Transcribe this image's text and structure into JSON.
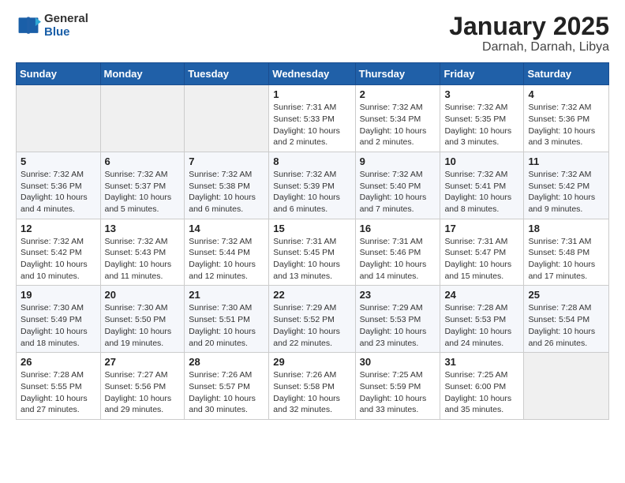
{
  "header": {
    "logo_general": "General",
    "logo_blue": "Blue",
    "title": "January 2025",
    "location": "Darnah, Darnah, Libya"
  },
  "days_of_week": [
    "Sunday",
    "Monday",
    "Tuesday",
    "Wednesday",
    "Thursday",
    "Friday",
    "Saturday"
  ],
  "weeks": [
    [
      {
        "day": "",
        "info": ""
      },
      {
        "day": "",
        "info": ""
      },
      {
        "day": "",
        "info": ""
      },
      {
        "day": "1",
        "info": "Sunrise: 7:31 AM\nSunset: 5:33 PM\nDaylight: 10 hours\nand 2 minutes."
      },
      {
        "day": "2",
        "info": "Sunrise: 7:32 AM\nSunset: 5:34 PM\nDaylight: 10 hours\nand 2 minutes."
      },
      {
        "day": "3",
        "info": "Sunrise: 7:32 AM\nSunset: 5:35 PM\nDaylight: 10 hours\nand 3 minutes."
      },
      {
        "day": "4",
        "info": "Sunrise: 7:32 AM\nSunset: 5:36 PM\nDaylight: 10 hours\nand 3 minutes."
      }
    ],
    [
      {
        "day": "5",
        "info": "Sunrise: 7:32 AM\nSunset: 5:36 PM\nDaylight: 10 hours\nand 4 minutes."
      },
      {
        "day": "6",
        "info": "Sunrise: 7:32 AM\nSunset: 5:37 PM\nDaylight: 10 hours\nand 5 minutes."
      },
      {
        "day": "7",
        "info": "Sunrise: 7:32 AM\nSunset: 5:38 PM\nDaylight: 10 hours\nand 6 minutes."
      },
      {
        "day": "8",
        "info": "Sunrise: 7:32 AM\nSunset: 5:39 PM\nDaylight: 10 hours\nand 6 minutes."
      },
      {
        "day": "9",
        "info": "Sunrise: 7:32 AM\nSunset: 5:40 PM\nDaylight: 10 hours\nand 7 minutes."
      },
      {
        "day": "10",
        "info": "Sunrise: 7:32 AM\nSunset: 5:41 PM\nDaylight: 10 hours\nand 8 minutes."
      },
      {
        "day": "11",
        "info": "Sunrise: 7:32 AM\nSunset: 5:42 PM\nDaylight: 10 hours\nand 9 minutes."
      }
    ],
    [
      {
        "day": "12",
        "info": "Sunrise: 7:32 AM\nSunset: 5:42 PM\nDaylight: 10 hours\nand 10 minutes."
      },
      {
        "day": "13",
        "info": "Sunrise: 7:32 AM\nSunset: 5:43 PM\nDaylight: 10 hours\nand 11 minutes."
      },
      {
        "day": "14",
        "info": "Sunrise: 7:32 AM\nSunset: 5:44 PM\nDaylight: 10 hours\nand 12 minutes."
      },
      {
        "day": "15",
        "info": "Sunrise: 7:31 AM\nSunset: 5:45 PM\nDaylight: 10 hours\nand 13 minutes."
      },
      {
        "day": "16",
        "info": "Sunrise: 7:31 AM\nSunset: 5:46 PM\nDaylight: 10 hours\nand 14 minutes."
      },
      {
        "day": "17",
        "info": "Sunrise: 7:31 AM\nSunset: 5:47 PM\nDaylight: 10 hours\nand 15 minutes."
      },
      {
        "day": "18",
        "info": "Sunrise: 7:31 AM\nSunset: 5:48 PM\nDaylight: 10 hours\nand 17 minutes."
      }
    ],
    [
      {
        "day": "19",
        "info": "Sunrise: 7:30 AM\nSunset: 5:49 PM\nDaylight: 10 hours\nand 18 minutes."
      },
      {
        "day": "20",
        "info": "Sunrise: 7:30 AM\nSunset: 5:50 PM\nDaylight: 10 hours\nand 19 minutes."
      },
      {
        "day": "21",
        "info": "Sunrise: 7:30 AM\nSunset: 5:51 PM\nDaylight: 10 hours\nand 20 minutes."
      },
      {
        "day": "22",
        "info": "Sunrise: 7:29 AM\nSunset: 5:52 PM\nDaylight: 10 hours\nand 22 minutes."
      },
      {
        "day": "23",
        "info": "Sunrise: 7:29 AM\nSunset: 5:53 PM\nDaylight: 10 hours\nand 23 minutes."
      },
      {
        "day": "24",
        "info": "Sunrise: 7:28 AM\nSunset: 5:53 PM\nDaylight: 10 hours\nand 24 minutes."
      },
      {
        "day": "25",
        "info": "Sunrise: 7:28 AM\nSunset: 5:54 PM\nDaylight: 10 hours\nand 26 minutes."
      }
    ],
    [
      {
        "day": "26",
        "info": "Sunrise: 7:28 AM\nSunset: 5:55 PM\nDaylight: 10 hours\nand 27 minutes."
      },
      {
        "day": "27",
        "info": "Sunrise: 7:27 AM\nSunset: 5:56 PM\nDaylight: 10 hours\nand 29 minutes."
      },
      {
        "day": "28",
        "info": "Sunrise: 7:26 AM\nSunset: 5:57 PM\nDaylight: 10 hours\nand 30 minutes."
      },
      {
        "day": "29",
        "info": "Sunrise: 7:26 AM\nSunset: 5:58 PM\nDaylight: 10 hours\nand 32 minutes."
      },
      {
        "day": "30",
        "info": "Sunrise: 7:25 AM\nSunset: 5:59 PM\nDaylight: 10 hours\nand 33 minutes."
      },
      {
        "day": "31",
        "info": "Sunrise: 7:25 AM\nSunset: 6:00 PM\nDaylight: 10 hours\nand 35 minutes."
      },
      {
        "day": "",
        "info": ""
      }
    ]
  ]
}
